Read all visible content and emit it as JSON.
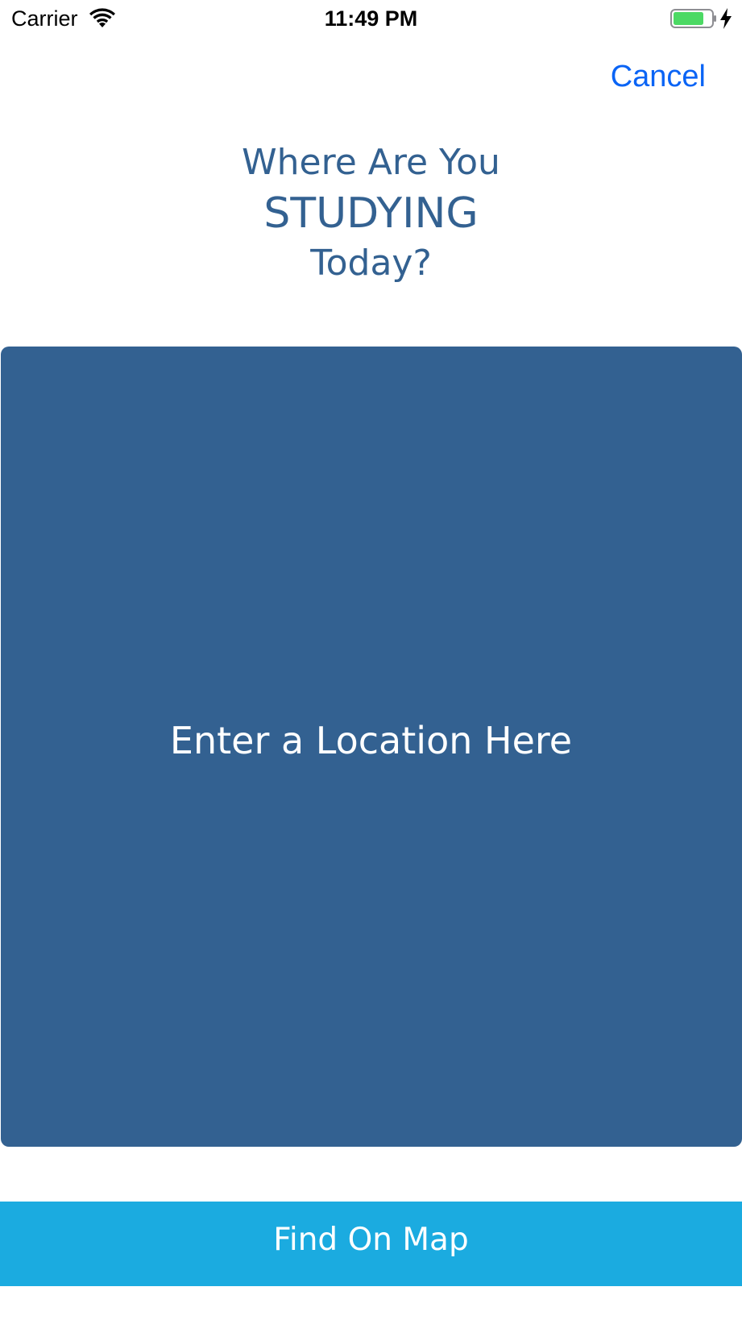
{
  "status_bar": {
    "carrier": "Carrier",
    "time": "11:49 PM",
    "wifi_icon": "wifi-icon",
    "battery_icon": "battery-charging-icon",
    "battery_level": 0.8,
    "battery_color": "#4cd964"
  },
  "nav": {
    "cancel_label": "Cancel",
    "cancel_color": "#0a64f5"
  },
  "heading": {
    "line1": "Where Are You",
    "line2": "STUDYING",
    "line3": "Today?",
    "color": "#336191"
  },
  "location_input": {
    "placeholder": "Enter a Location Here",
    "background": "#336191"
  },
  "find_button": {
    "label": "Find On Map",
    "background": "#1babe0"
  }
}
